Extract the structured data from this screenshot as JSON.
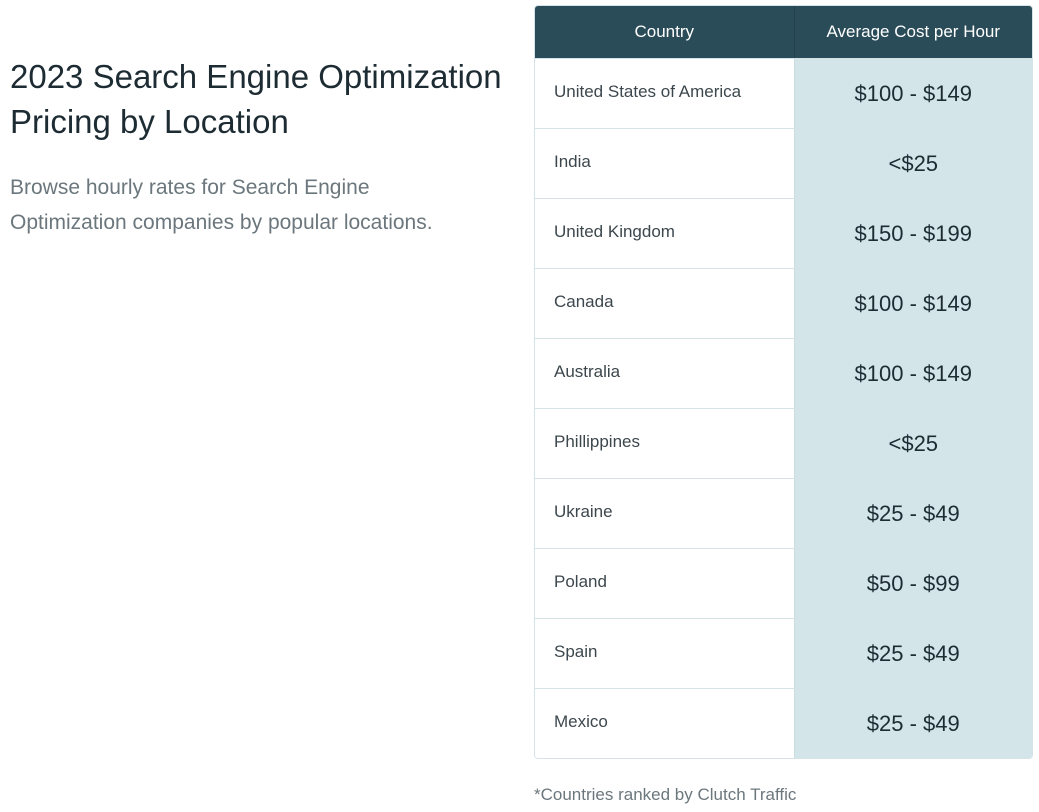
{
  "intro": {
    "title": "2023 Search Engine Optimization Pricing by Location",
    "subtitle": "Browse hourly rates for Search Engine Optimization companies by popular locations."
  },
  "table": {
    "headers": {
      "country": "Country",
      "cost": "Average Cost per Hour"
    },
    "rows": [
      {
        "country": "United States of America",
        "cost": "$100 - $149"
      },
      {
        "country": "India",
        "cost": "<$25"
      },
      {
        "country": "United Kingdom",
        "cost": "$150 - $199"
      },
      {
        "country": "Canada",
        "cost": "$100 - $149"
      },
      {
        "country": "Australia",
        "cost": "$100 - $149"
      },
      {
        "country": "Phillippines",
        "cost": "<$25"
      },
      {
        "country": "Ukraine",
        "cost": "$25 - $49"
      },
      {
        "country": "Poland",
        "cost": "$50 - $99"
      },
      {
        "country": "Spain",
        "cost": "$25 - $49"
      },
      {
        "country": "Mexico",
        "cost": "$25 - $49"
      }
    ],
    "footnote": "*Countries ranked by Clutch Traffic"
  },
  "colors": {
    "header_bg": "#2a4b58",
    "cost_cell_bg": "#d3e5e8",
    "title_text": "#1d2b33",
    "muted_text": "#6b777d"
  }
}
